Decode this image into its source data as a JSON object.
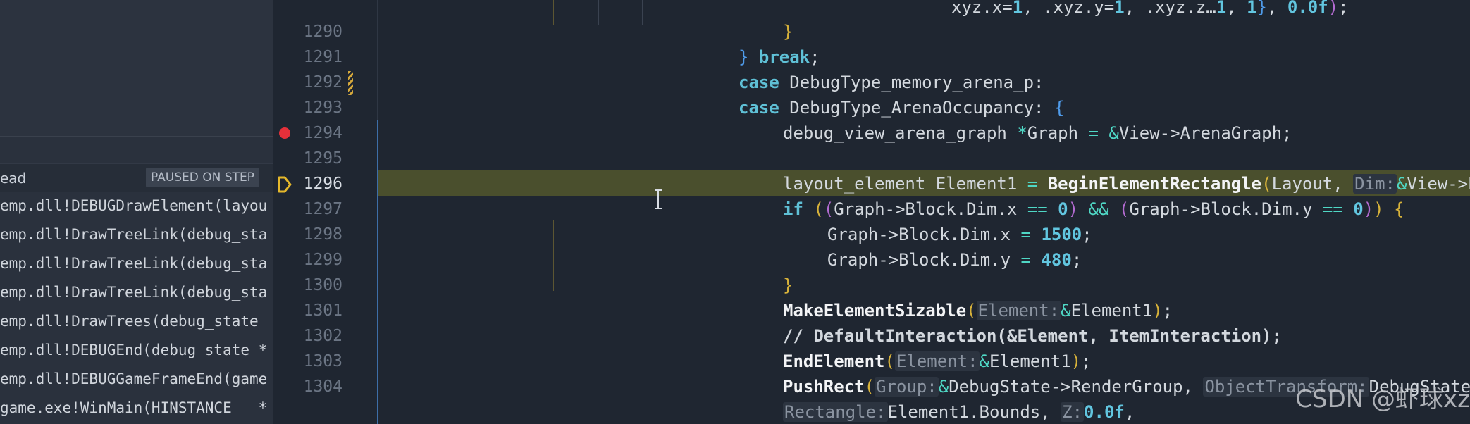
{
  "callstack": {
    "thread_label": "ead",
    "paused_badge": "PAUSED ON STEP",
    "frames": [
      "emp.dll!DEBUGDrawElement(layou",
      "emp.dll!DrawTreeLink(debug_sta",
      "emp.dll!DrawTreeLink(debug_sta",
      "emp.dll!DrawTreeLink(debug_sta",
      "emp.dll!DrawTrees(debug_state ",
      "emp.dll!DEBUGEnd(debug_state *",
      "emp.dll!DEBUGGameFrameEnd(game",
      "game.exe!WinMain(HINSTANCE__ *"
    ]
  },
  "editor": {
    "line_numbers": [
      "1290",
      "1291",
      "1292",
      "1293",
      "1294",
      "1295",
      "1296",
      "1297",
      "1298",
      "1299",
      "1300",
      "1301",
      "1302",
      "1303",
      "1304"
    ],
    "current_line": "1296",
    "breakpoint_line": "1294",
    "code": {
      "l0_a": "xyz.x=",
      "l0_b": "1",
      "l0_c": ", ",
      "l0_d": ".xyz.y=",
      "l0_e": "1",
      "l0_f": ", ",
      "l0_g": ".xyz.z…",
      "l0_h": "1",
      "l0_i": ", ",
      "l0_j": "1",
      "l0_k": "}",
      "l0_l": ", ",
      "l0_m": "0.0f",
      "l0_n": ")",
      "l0_o": ";",
      "l1_brace": "}",
      "l2_brace": "} ",
      "l2_break": "break",
      "l2_semi": ";",
      "l3_case": "case",
      "l3_rest": " DebugType_memory_arena_p:",
      "l4_case": "case",
      "l4_rest": " DebugType_ArenaOccupancy: ",
      "l4_brace": "{",
      "l5_type": "debug_view_arena_graph ",
      "l5_star": "*",
      "l5_var": "Graph ",
      "l5_eq": "=",
      "l5_sp": " ",
      "l5_amp": "&",
      "l5_rest": "View->ArenaGraph;",
      "l7_type": "layout_element Element1 ",
      "l7_eq": "=",
      "l7_sp": " ",
      "l7_fn": "BeginElementRectangle",
      "l7_p": "(",
      "l7_arg": "Layout, ",
      "l7_hint": "Dim:",
      "l7_amp": "&",
      "l7_rest": "View->ProfileGraph.Block.",
      "l8_if": "if",
      "l8_sp": " ",
      "l8_p1": "(",
      "l8_p2": "(",
      "l8_a": "Graph->Block.Dim.x ",
      "l8_eq": "==",
      "l8_sp2": " ",
      "l8_n1": "0",
      "l8_c1": ")",
      "l8_sp3": " ",
      "l8_and": "&&",
      "l8_sp4": " ",
      "l8_p3": "(",
      "l8_b": "Graph->Block.Dim.y ",
      "l8_eq2": "==",
      "l8_sp5": " ",
      "l8_n2": "0",
      "l8_c2": ")",
      "l8_c3": ")",
      "l8_sp6": " ",
      "l8_brace": "{",
      "l9_a": "Graph->Block.Dim.x ",
      "l9_eq": "=",
      "l9_sp": " ",
      "l9_n": "1500",
      "l9_semi": ";",
      "l10_a": "Graph->Block.Dim.y ",
      "l10_eq": "=",
      "l10_sp": " ",
      "l10_n": "480",
      "l10_semi": ";",
      "l11_brace": "}",
      "l12_fn": "MakeElementSizable",
      "l12_p": "(",
      "l12_hint": "Element:",
      "l12_amp": "&",
      "l12_rest": "Element1",
      "l12_c": ")",
      "l12_semi": ";",
      "l13_cmt": "// DefaultInteraction(&Element, ItemInteraction);",
      "l14_fn": "EndElement",
      "l14_p": "(",
      "l14_hint": "Element:",
      "l14_amp": "&",
      "l14_rest": "Element1",
      "l14_c": ")",
      "l14_semi": ";",
      "l15_fn": "PushRect",
      "l15_p": "(",
      "l15_hint1": "Group:",
      "l15_amp": "&",
      "l15_a": "DebugState->RenderGroup, ",
      "l15_hint2": "ObjectTransform:",
      "l15_b": "DebugState->BackingTransform,",
      "l16_hint1": "Rectangle:",
      "l16_a": "Element1.Bounds, ",
      "l16_hint2": "Z:",
      "l16_n": "0.0f",
      "l16_c": ","
    }
  },
  "watermark": "CSDN @虾球xz",
  "colors": {
    "background": "#1f2631",
    "keyword": "#5fc0d6",
    "number": "#62c6e0",
    "current_line": "#4a4f2d",
    "breakpoint": "#e5303a",
    "exec_arrow": "#e5b82b"
  }
}
